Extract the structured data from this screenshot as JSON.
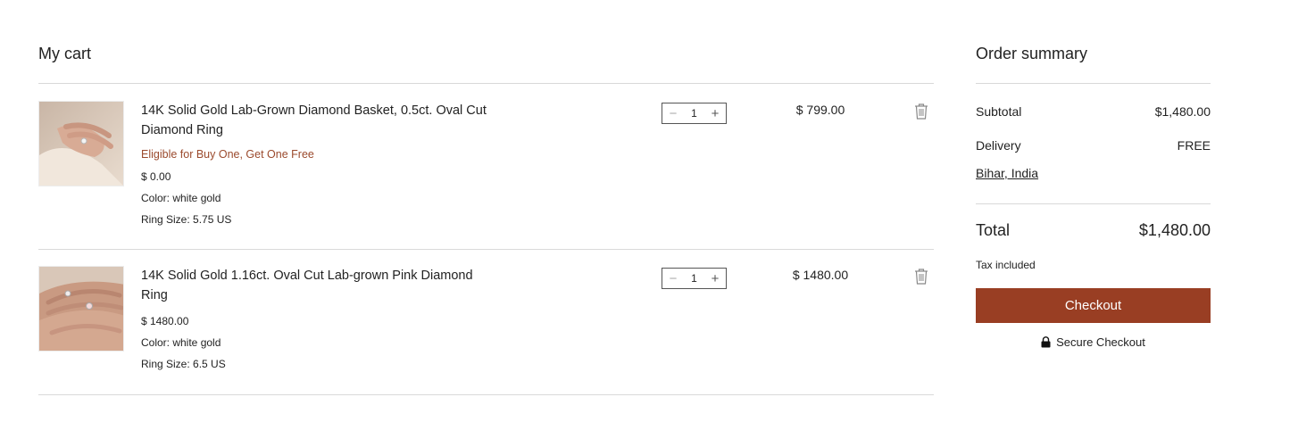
{
  "cart": {
    "title": "My cart",
    "items": [
      {
        "name": "14K Solid Gold Lab-Grown Diamond Basket, 0.5ct. Oval Cut Diamond Ring",
        "promo": "Eligible for Buy One, Get One Free",
        "unit_price": "$ 0.00",
        "color": "Color: white gold",
        "size": "Ring Size: 5.75 US",
        "quantity": "1",
        "price": "$ 799.00",
        "thumb_icon": "ring-hand-photo"
      },
      {
        "name": "14K Solid Gold 1.16ct. Oval Cut Lab-grown Pink Diamond Ring",
        "promo": "",
        "unit_price": "$ 1480.00",
        "color": "Color: white gold",
        "size": "Ring Size: 6.5 US",
        "quantity": "1",
        "price": "$ 1480.00",
        "thumb_icon": "ring-hands-photo"
      }
    ],
    "icons": {
      "minus": "−",
      "plus": "+",
      "remove": "trash-icon"
    }
  },
  "summary": {
    "title": "Order summary",
    "subtotal_label": "Subtotal",
    "subtotal_value": "$1,480.00",
    "delivery_label": "Delivery",
    "delivery_value": "FREE",
    "location": "Bihar, India",
    "total_label": "Total",
    "total_value": "$1,480.00",
    "tax_note": "Tax included",
    "checkout_label": "Checkout",
    "secure_label": "Secure Checkout"
  },
  "colors": {
    "accent": "#993e23",
    "promo_text": "#9b4a2d",
    "divider": "#d9d9d9"
  }
}
